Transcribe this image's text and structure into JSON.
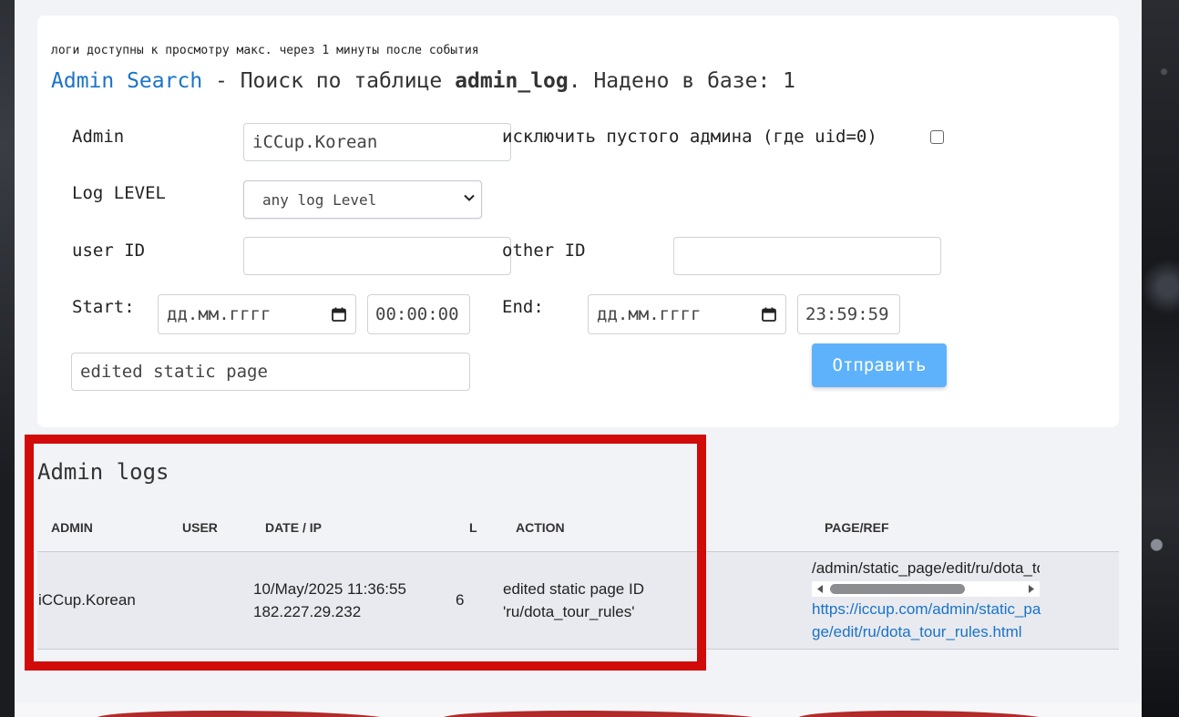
{
  "search": {
    "notice": "логи доступны к просмотру макс. через 1 минуты после события",
    "title_link": "Admin Search",
    "title_mid": " - Поиск по таблице ",
    "title_table": "admin_log",
    "title_tail": ". Надено в базе: 1",
    "admin_label": "Admin",
    "admin_value": "iCCup.Korean",
    "exclude_label": "исключить пустого админа (где uid=0)",
    "exclude_checked": false,
    "log_level_label": "Log LEVEL",
    "log_level_value": "any log Level",
    "user_id_label": "user ID",
    "user_id_value": "",
    "other_id_label": "other ID",
    "other_id_value": "",
    "start_label": "Start:",
    "start_date": "дд.мм.гггг",
    "start_time": "00:00:00",
    "end_label": "End:",
    "end_date": "дд.мм.гггг",
    "end_time": "23:59:59",
    "action_value": "edited static page",
    "submit_label": "Отправить"
  },
  "logs": {
    "title": "Admin logs",
    "columns": [
      "ADMIN",
      "USER",
      "DATE / IP",
      "L",
      "ACTION",
      "PAGE/REF"
    ],
    "rows": [
      {
        "admin": "iCCup.Korean",
        "user": "",
        "date": "10/May/2025 11:36:55",
        "ip": "182.227.29.232",
        "level": "6",
        "action_line1": "edited static page ID",
        "action_line2": "'ru/dota_tour_rules'",
        "page": "/admin/static_page/edit/ru/dota_to",
        "ref_line1": "https://iccup.com/admin/static_pa",
        "ref_line2": "ge/edit/ru/dota_tour_rules.html"
      }
    ]
  },
  "colors": {
    "accent": "#1a73c8",
    "button": "#5db2fb",
    "highlight": "#d10a0a"
  }
}
